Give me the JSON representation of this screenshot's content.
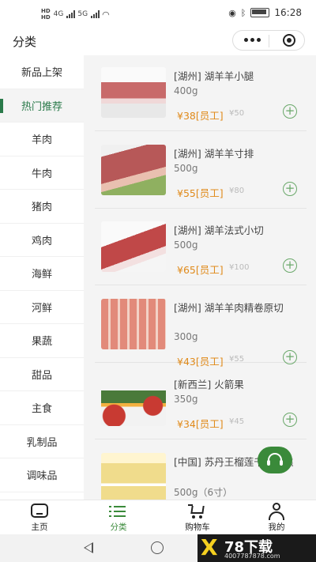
{
  "status": {
    "time": "16:28",
    "net1": "4G",
    "net2": "5G"
  },
  "nav": {
    "title": "分类"
  },
  "sidebar": {
    "items": [
      {
        "label": "新品上架"
      },
      {
        "label": "热门推荐"
      },
      {
        "label": "羊肉"
      },
      {
        "label": "牛肉"
      },
      {
        "label": "猪肉"
      },
      {
        "label": "鸡肉"
      },
      {
        "label": "海鲜"
      },
      {
        "label": "河鲜"
      },
      {
        "label": "果蔬"
      },
      {
        "label": "甜品"
      },
      {
        "label": "主食"
      },
      {
        "label": "乳制品"
      },
      {
        "label": "调味品"
      }
    ],
    "active": "热门推荐"
  },
  "products": [
    {
      "name": "[湖州] 湖羊羊小腿",
      "spec": "400g",
      "price": "¥38[员工]",
      "orig": "¥50"
    },
    {
      "name": "[湖州] 湖羊羊寸排",
      "spec": "500g",
      "price": "¥55[员工]",
      "orig": "¥80"
    },
    {
      "name": "[湖州] 湖羊法式小切",
      "spec": "500g",
      "price": "¥65[员工]",
      "orig": "¥100"
    },
    {
      "name": "[湖州] 湖羊羊肉精卷原切",
      "spec": "300g",
      "price": "¥43[员工]",
      "orig": "¥55"
    },
    {
      "name": "[新西兰] 火箭果",
      "spec": "350g",
      "price": "¥34[员工]",
      "orig": "¥45"
    },
    {
      "name": "[中国] 苏丹王榴莲千层蛋糕",
      "spec": "500g（6寸）",
      "price": "",
      "orig": ""
    }
  ],
  "add_symbol": "+",
  "product_images": [
    {
      "icon": "lamb-shank-image",
      "colors": [
        "#c86a6a",
        "#f0d8d8"
      ]
    },
    {
      "icon": "lamb-chop-image",
      "colors": [
        "#b75858",
        "#8fb060"
      ]
    },
    {
      "icon": "lamb-rack-image",
      "colors": [
        "#c04848",
        "#f5f5f5"
      ]
    },
    {
      "icon": "lamb-roll-image",
      "colors": [
        "#e28a7a",
        "#f3d2c6"
      ]
    },
    {
      "icon": "rocket-apple-image",
      "colors": [
        "#c83a32",
        "#f2b040"
      ]
    },
    {
      "icon": "durian-cake-image",
      "colors": [
        "#f0dc8c",
        "#fff5d0"
      ]
    }
  ],
  "tabs": [
    {
      "label": "主页",
      "icon": "home-icon"
    },
    {
      "label": "分类",
      "icon": "category-list-icon"
    },
    {
      "label": "购物车",
      "icon": "cart-icon"
    },
    {
      "label": "我的",
      "icon": "user-icon"
    }
  ],
  "active_tab": "分类",
  "colors": {
    "accent": "#3a8a3a",
    "price": "#e08a1a"
  },
  "watermark": {
    "mark": "X",
    "title": "78下载",
    "url": "4007787878.com"
  }
}
